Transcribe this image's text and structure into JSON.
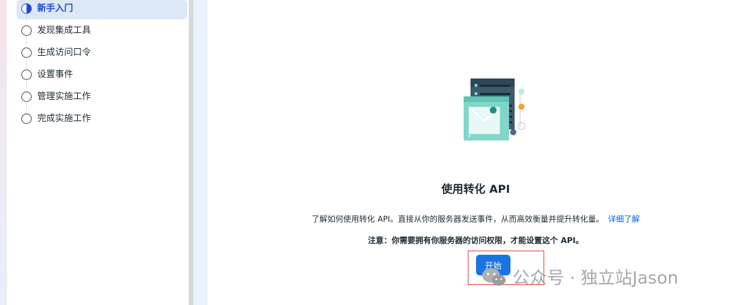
{
  "sidebar": {
    "steps": [
      {
        "label": "新手入门",
        "state": "active"
      },
      {
        "label": "发现集成工具",
        "state": "pending"
      },
      {
        "label": "生成访问口令",
        "state": "pending"
      },
      {
        "label": "设置事件",
        "state": "pending"
      },
      {
        "label": "管理实施工作",
        "state": "pending"
      },
      {
        "label": "完成实施工作",
        "state": "pending"
      }
    ]
  },
  "main": {
    "title": "使用转化 API",
    "description": "了解如何使用转化 API。直接从你的服务器发送事件，从而高效衡量并提升转化量。",
    "learn_more": "详细了解",
    "note": "注意：你需要拥有你服务器的访问权限，才能设置这个 API。",
    "start_button": "开始"
  },
  "watermark": {
    "text": "公众号 · 独立站Jason",
    "icon": "wechat-icon"
  },
  "colors": {
    "primary_button": "#1b74e4",
    "active_step": "#1b4ad6",
    "active_step_bg": "#dce8f6",
    "link": "#0064e0",
    "highlight_border": "#e0463a"
  }
}
